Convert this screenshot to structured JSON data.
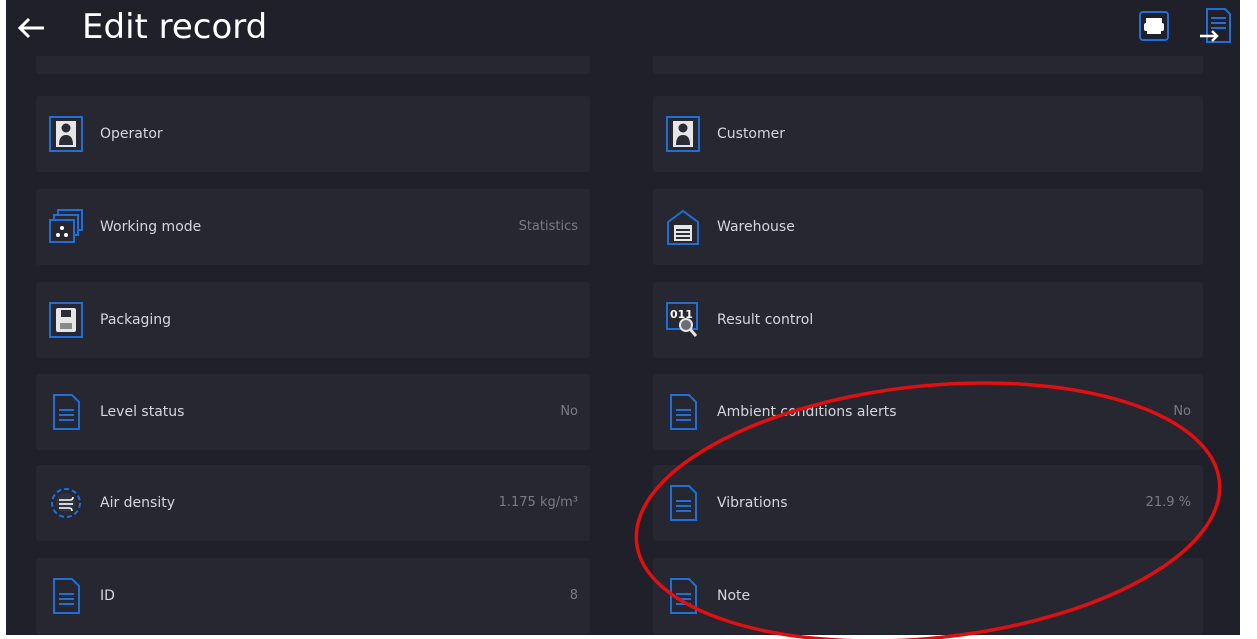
{
  "header": {
    "back_icon": "arrow-left-icon",
    "title": "Edit record",
    "print_icon": "printer-icon",
    "export_icon": "export-document-icon"
  },
  "left_items": [
    {
      "label": "Operator",
      "value": "",
      "icon": "user-icon"
    },
    {
      "label": "Working mode",
      "value": "Statistics",
      "icon": "working-mode-icon"
    },
    {
      "label": "Packaging",
      "value": "",
      "icon": "packaging-icon"
    },
    {
      "label": "Level status",
      "value": "No",
      "icon": "document-icon"
    },
    {
      "label": "Air density",
      "value": "1.175 kg/m³",
      "icon": "air-density-icon"
    },
    {
      "label": "ID",
      "value": "8",
      "icon": "document-icon"
    }
  ],
  "right_items": [
    {
      "label": "Customer",
      "value": "",
      "icon": "user-icon"
    },
    {
      "label": "Warehouse",
      "value": "",
      "icon": "warehouse-icon"
    },
    {
      "label": "Result control",
      "value": "",
      "icon": "result-control-icon"
    },
    {
      "label": "Ambient conditions alerts",
      "value": "No",
      "icon": "document-icon"
    },
    {
      "label": "Vibrations",
      "value": "21.9 %",
      "icon": "document-icon"
    },
    {
      "label": "Note",
      "value": "",
      "icon": "document-icon"
    }
  ],
  "annotation": {
    "shape": "ellipse",
    "color": "#e01010"
  },
  "colors": {
    "background": "#1f2029",
    "tile": "#262731",
    "icon_accent": "#1f6fd6",
    "text": "#d6d6da",
    "value_text": "#7a7b85"
  }
}
